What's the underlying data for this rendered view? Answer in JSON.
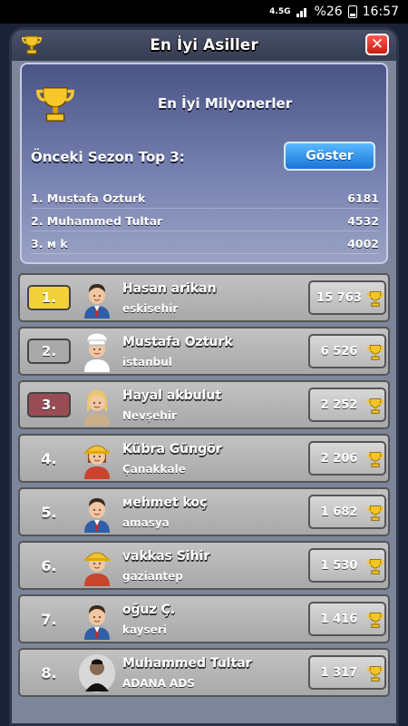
{
  "status_bar": {
    "network": "4.5G",
    "battery": "%26",
    "time": "16:57"
  },
  "modal": {
    "title": "En İyi Asiller",
    "close_label": "✕"
  },
  "top_panel": {
    "title": "En İyi Milyonerler",
    "season_label": "Önceki Sezon Top 3:",
    "show_button": "Göster",
    "previous_top3": [
      {
        "name": "1. Mustafa  Ozturk",
        "score": "6181"
      },
      {
        "name": "2. Muhammed Tultar",
        "score": "4532"
      },
      {
        "name": "3. м k",
        "score": "4002"
      }
    ]
  },
  "rankings": [
    {
      "rank": "1.",
      "name": "Hasan arikan",
      "city": "eskisehir",
      "score": "15 763",
      "badge": "gold",
      "avatar": "man-suit"
    },
    {
      "rank": "2.",
      "name": "Mustafa  Ozturk",
      "city": "istanbul",
      "score": "6 526",
      "badge": "silver",
      "avatar": "chef"
    },
    {
      "rank": "3.",
      "name": "Hayal akbulut",
      "city": "Nevşehir",
      "score": "2 252",
      "badge": "bronze",
      "avatar": "woman-blonde"
    },
    {
      "rank": "4.",
      "name": "Kübra  Güngör",
      "city": "Çanakkale",
      "score": "2 206",
      "badge": "none",
      "avatar": "firefighter-woman"
    },
    {
      "rank": "5.",
      "name": "мehmet koç",
      "city": "amasya",
      "score": "1 682",
      "badge": "none",
      "avatar": "man-suit"
    },
    {
      "rank": "6.",
      "name": "vakkas Sihir",
      "city": "gaziantep",
      "score": "1 530",
      "badge": "none",
      "avatar": "firefighter-man"
    },
    {
      "rank": "7.",
      "name": "oğuz Ç.",
      "city": "kayseri",
      "score": "1 416",
      "badge": "none",
      "avatar": "man-suit"
    },
    {
      "rank": "8.",
      "name": "Muhammed Tultar",
      "city": "ADANA ADS",
      "score": "1 317",
      "badge": "none",
      "avatar": "photo-man"
    }
  ],
  "colors": {
    "gold_badge": "#f2d13a",
    "silver_badge": "#a9a9a9",
    "bronze_badge": "#9a4c55",
    "show_button": "#2a8ae6",
    "panel": "#6c76a6"
  }
}
